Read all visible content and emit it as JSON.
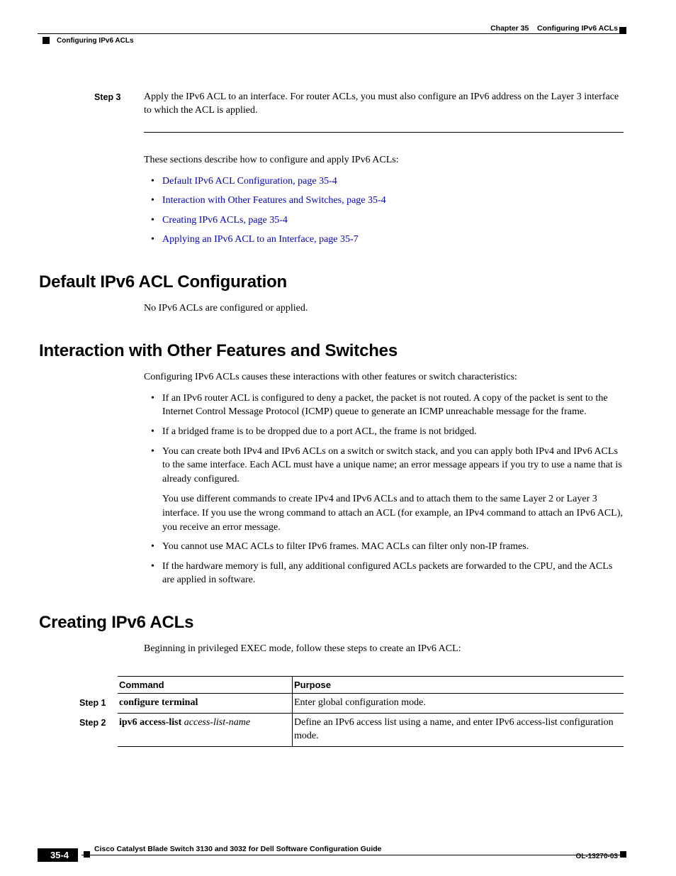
{
  "header": {
    "chapter_label": "Chapter 35",
    "chapter_title": "Configuring IPv6 ACLs",
    "section_crumb": "Configuring IPv6 ACLs"
  },
  "step3": {
    "label": "Step 3",
    "text": "Apply the IPv6 ACL to an interface. For router ACLs, you must also configure an IPv6 address on the Layer 3 interface to which the ACL is applied."
  },
  "intro_para": "These sections describe how to configure and apply IPv6 ACLs:",
  "intro_links": [
    "Default IPv6 ACL Configuration, page 35-4",
    "Interaction with Other Features and Switches, page 35-4",
    "Creating IPv6 ACLs, page 35-4",
    "Applying an IPv6 ACL to an Interface, page 35-7"
  ],
  "sec1": {
    "heading": "Default IPv6 ACL Configuration",
    "body": "No IPv6 ACLs are configured or applied."
  },
  "sec2": {
    "heading": "Interaction with Other Features and Switches",
    "intro": "Configuring IPv6 ACLs causes these interactions with other features or switch characteristics:",
    "bullets": [
      {
        "text": "If an IPv6 router ACL is configured to deny a packet, the packet is not routed. A copy of the packet is sent to the Internet Control Message Protocol (ICMP) queue to generate an ICMP unreachable message for the frame."
      },
      {
        "text": "If a bridged frame is to be dropped due to a port ACL, the frame is not bridged."
      },
      {
        "text": "You can create both IPv4 and IPv6 ACLs on a switch or switch stack, and you can apply both IPv4 and IPv6 ACLs to the same interface. Each ACL must have a unique name; an error message appears if you try to use a name that is already configured.",
        "sub": "You use different commands to create IPv4 and IPv6 ACLs and to attach them to the same Layer 2 or Layer 3 interface. If you use the wrong command to attach an ACL (for example, an IPv4 command to attach an IPv6 ACL), you receive an error message."
      },
      {
        "text": "You cannot use MAC ACLs to filter IPv6 frames. MAC ACLs can filter only non-IP frames."
      },
      {
        "text": "If the hardware memory is full, any additional configured ACLs packets are forwarded to the CPU, and the ACLs are applied in software."
      }
    ]
  },
  "sec3": {
    "heading": "Creating IPv6 ACLs",
    "intro": "Beginning in privileged EXEC mode, follow these steps to create an IPv6 ACL:",
    "table": {
      "headers": {
        "command": "Command",
        "purpose": "Purpose"
      },
      "rows": [
        {
          "step": "Step 1",
          "command_bold": "configure terminal",
          "command_italic": "",
          "purpose": "Enter global configuration mode."
        },
        {
          "step": "Step 2",
          "command_bold": "ipv6 access-list",
          "command_italic": " access-list-name",
          "purpose": "Define an IPv6 access list using a name, and enter IPv6 access-list configuration mode."
        }
      ]
    }
  },
  "footer": {
    "guide_title": "Cisco Catalyst Blade Switch 3130 and 3032 for Dell Software Configuration Guide",
    "page_num": "35-4",
    "doc_id": "OL-13270-03"
  }
}
